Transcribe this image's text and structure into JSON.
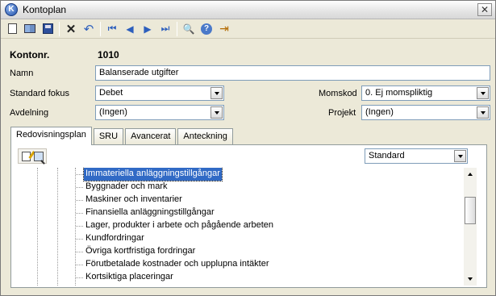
{
  "window": {
    "title": "Kontoplan",
    "app_icon_letter": "K",
    "close_glyph": "✕"
  },
  "toolbar": {
    "icons": [
      "new-document-icon",
      "open-book-icon",
      "save-icon",
      "delete-icon",
      "undo-icon",
      "first-record-icon",
      "previous-record-icon",
      "next-record-icon",
      "last-record-icon",
      "print-preview-icon",
      "help-icon",
      "exit-icon"
    ],
    "delete_glyph": "✕",
    "undo_glyph": "↶",
    "first_glyph": "⏮",
    "prev_glyph": "◀",
    "next_glyph": "▶",
    "last_glyph": "⏭",
    "preview_glyph": "🔍",
    "help_glyph": "?",
    "exit_glyph": "⇥"
  },
  "form": {
    "kontonr_label": "Kontonr.",
    "kontonr_value": "1010",
    "namn_label": "Namn",
    "namn_value": "Balanserade utgifter",
    "standard_fokus_label": "Standard fokus",
    "standard_fokus_value": "Debet",
    "momskod_label": "Momskod",
    "momskod_value": "0. Ej momspliktig",
    "avdelning_label": "Avdelning",
    "avdelning_value": "(Ingen)",
    "projekt_label": "Projekt",
    "projekt_value": "(Ingen)"
  },
  "tabs": [
    {
      "label": "Redovisningsplan",
      "active": true
    },
    {
      "label": "SRU",
      "active": false
    },
    {
      "label": "Avancerat",
      "active": false
    },
    {
      "label": "Anteckning",
      "active": false
    }
  ],
  "panel": {
    "view_select_value": "Standard",
    "tree_items": [
      {
        "label": "Immateriella anläggningstillgångar",
        "selected": true
      },
      {
        "label": "Byggnader och mark",
        "selected": false
      },
      {
        "label": "Maskiner och inventarier",
        "selected": false
      },
      {
        "label": "Finansiella anläggningstillgångar",
        "selected": false
      },
      {
        "label": "Lager, produkter i arbete och pågående arbeten",
        "selected": false
      },
      {
        "label": "Kundfordringar",
        "selected": false
      },
      {
        "label": "Övriga kortfristiga fordringar",
        "selected": false
      },
      {
        "label": "Förutbetalade kostnader och upplupna intäkter",
        "selected": false
      },
      {
        "label": "Kortsiktiga placeringar",
        "selected": false
      }
    ]
  },
  "colors": {
    "selection": "#316ac5",
    "field_border": "#7f9db9",
    "window_bg": "#ece9d8"
  }
}
